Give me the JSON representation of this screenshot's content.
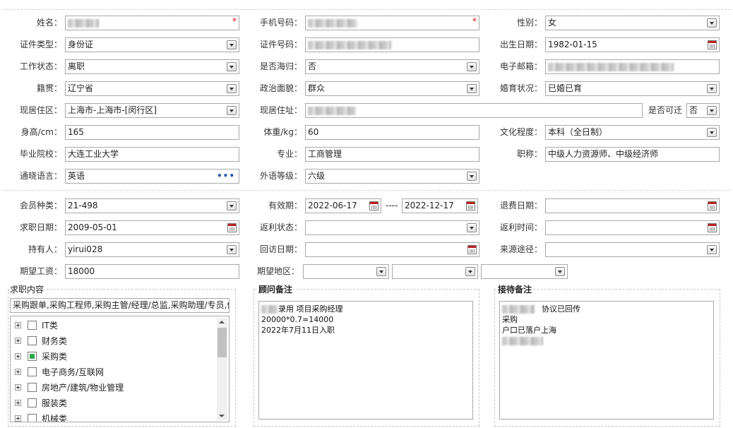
{
  "basic": {
    "name": {
      "label": "姓名：",
      "value": "",
      "required": "*"
    },
    "phone": {
      "label": "手机号码：",
      "value": "",
      "required": "*"
    },
    "gender": {
      "label": "性别：",
      "value": "女"
    },
    "id_type": {
      "label": "证件类型：",
      "value": "身份证"
    },
    "id_number": {
      "label": "证件号码：",
      "value": ""
    },
    "birth_date": {
      "label": "出生日期：",
      "value": "1982-01-15"
    },
    "work_status": {
      "label": "工作状态：",
      "value": "离职"
    },
    "overseas": {
      "label": "是否海归：",
      "value": "否"
    },
    "email": {
      "label": "电子邮箱：",
      "value": ""
    },
    "native_place": {
      "label": "籍贯：",
      "value": "辽宁省"
    },
    "political": {
      "label": "政治面貌：",
      "value": "群众"
    },
    "marital": {
      "label": "婚育状况：",
      "value": "已婚已育"
    },
    "residence_area": {
      "label": "现居住区：",
      "value": "上海市-上海市-[闵行区]"
    },
    "residence_address": {
      "label": "现居住址：",
      "value": ""
    },
    "relocatable": {
      "label": "是否可迁",
      "value": "否"
    },
    "height": {
      "label": "身高/cm：",
      "value": "165"
    },
    "weight": {
      "label": "体重/kg：",
      "value": "60"
    },
    "education": {
      "label": "文化程度：",
      "value": "本科（全日制）"
    },
    "school": {
      "label": "毕业院校：",
      "value": "大连工业大学"
    },
    "major": {
      "label": "专业：",
      "value": "工商管理"
    },
    "title": {
      "label": "职称：",
      "value": "中级人力资源师、中级经济师"
    },
    "language": {
      "label": "通晓语言：",
      "value": "英语",
      "more": "•••"
    },
    "language_level": {
      "label": "外语等级：",
      "value": "六级"
    }
  },
  "membership": {
    "member_type": {
      "label": "会员种类：",
      "value": "21-498"
    },
    "validity": {
      "label": "有效期：",
      "start": "2022-06-17",
      "separator": "----",
      "end": "2022-12-17"
    },
    "refund_date": {
      "label": "退费日期：",
      "value": ""
    },
    "job_search_date": {
      "label": "求职日期：",
      "value": "2009-05-01"
    },
    "rebate_status": {
      "label": "返利状态：",
      "value": ""
    },
    "rebate_time": {
      "label": "返利时间：",
      "value": ""
    },
    "holder": {
      "label": "持有人：",
      "value": "yirui028"
    },
    "revisit_date": {
      "label": "回访日期：",
      "value": ""
    },
    "source": {
      "label": "来源途径：",
      "value": ""
    },
    "expected_salary": {
      "label": "期望工资：",
      "value": "18000"
    },
    "expected_region": {
      "label": "期望地区：",
      "value1": "",
      "value2": "",
      "value3": ""
    }
  },
  "job_content": {
    "title": "求职内容",
    "value": "采购跟单,采购工程师,采购主管/经理/总监,采购助理/专员,供",
    "tree": [
      {
        "label": "IT类",
        "checked": "none"
      },
      {
        "label": "财务类",
        "checked": "none"
      },
      {
        "label": "采购类",
        "checked": "partial"
      },
      {
        "label": "电子商务/互联网",
        "checked": "none"
      },
      {
        "label": "房地产/建筑/物业管理",
        "checked": "none"
      },
      {
        "label": "服装类",
        "checked": "none"
      },
      {
        "label": "机械类",
        "checked": "none"
      }
    ]
  },
  "consultant_note": {
    "title": "顾问备注",
    "line1": "录用  项目采购经理",
    "line2": "20000*0.7=14000",
    "line3": "2022年7月11日入职"
  },
  "reception_note": {
    "title": "接待备注",
    "line1": "协议已回传",
    "line2": "采购",
    "line3": "户口已落户上海"
  },
  "colors": {
    "border": "#a9a9a9",
    "required": "#dd0000",
    "partial_check": "#2fa84f",
    "more_dots": "#2a5caa"
  }
}
